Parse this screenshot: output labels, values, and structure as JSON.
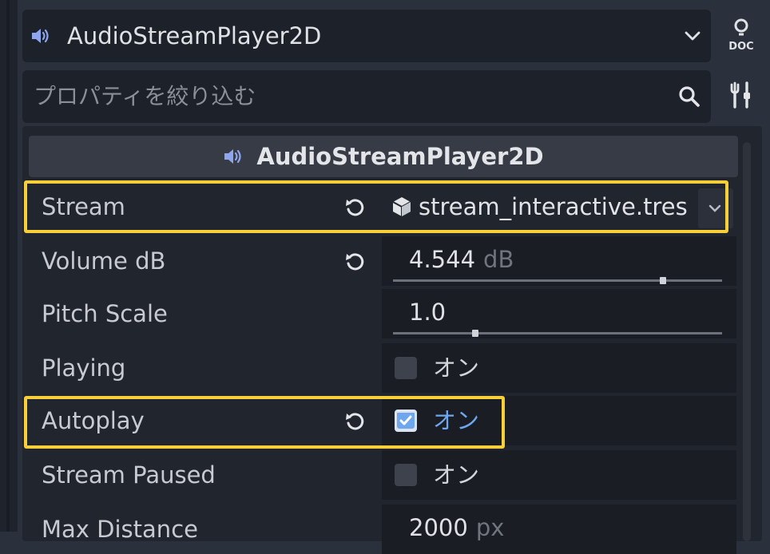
{
  "header": {
    "node_name": "AudioStreamPlayer2D"
  },
  "filter": {
    "placeholder": "プロパティを絞り込む"
  },
  "section": {
    "title": "AudioStreamPlayer2D"
  },
  "properties": {
    "stream": {
      "label": "Stream",
      "value": "stream_interactive.tres"
    },
    "volume_db": {
      "label": "Volume dB",
      "value": "4.544",
      "unit": "dB",
      "slider_fraction": 0.82
    },
    "pitch_scale": {
      "label": "Pitch Scale",
      "value": "1.0",
      "slider_fraction": 0.25
    },
    "playing": {
      "label": "Playing",
      "checked": false,
      "text": "オン"
    },
    "autoplay": {
      "label": "Autoplay",
      "checked": true,
      "text": "オン"
    },
    "stream_paused": {
      "label": "Stream Paused",
      "checked": false,
      "text": "オン"
    },
    "max_distance": {
      "label": "Max Distance",
      "value": "2000",
      "unit": "px"
    }
  },
  "colors": {
    "accent": "#6ea7ee",
    "highlight": "#f6cf3b",
    "speaker_icon": "#8fa6ee"
  }
}
